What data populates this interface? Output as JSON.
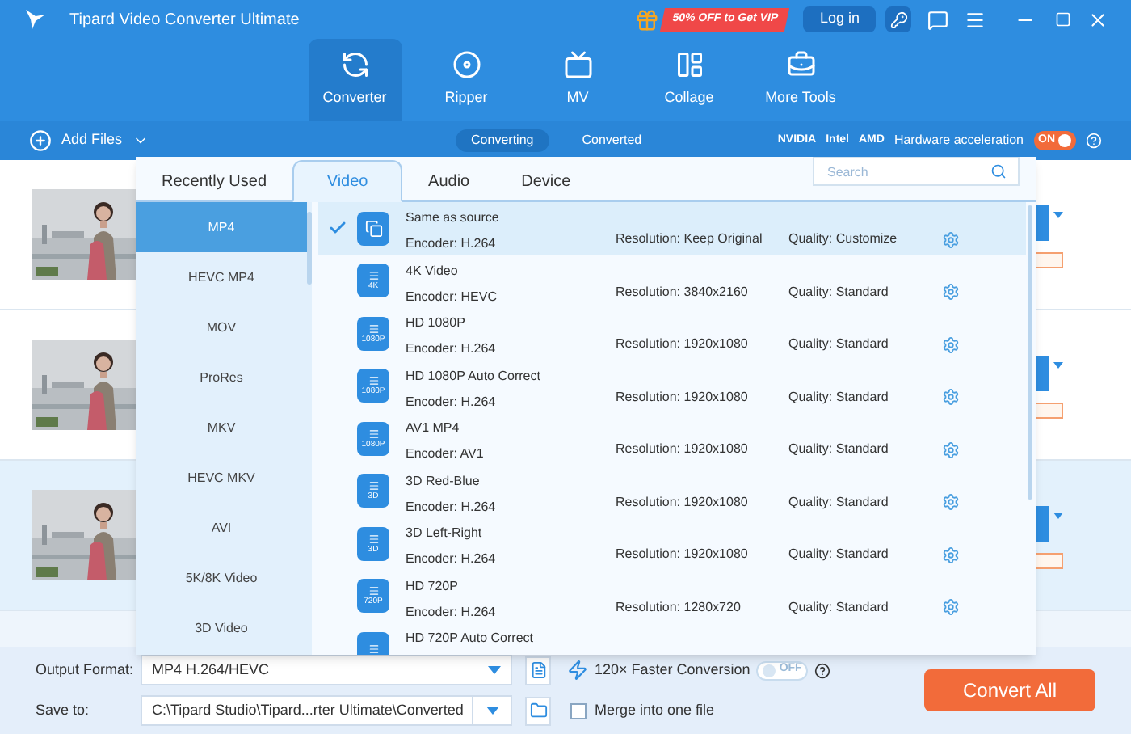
{
  "window": {
    "title": "Tipard Video Converter Ultimate"
  },
  "promo": {
    "label": "50% OFF to Get VIP"
  },
  "login": {
    "label": "Log in"
  },
  "nav": [
    {
      "label": "Converter",
      "selected": true
    },
    {
      "label": "Ripper",
      "selected": false
    },
    {
      "label": "MV",
      "selected": false
    },
    {
      "label": "Collage",
      "selected": false
    },
    {
      "label": "More Tools",
      "selected": false
    }
  ],
  "toolbar": {
    "add_files": "Add Files",
    "views": [
      {
        "label": "Converting",
        "selected": true
      },
      {
        "label": "Converted",
        "selected": false
      }
    ],
    "gpus": [
      "NVIDIA",
      "Intel",
      "AMD"
    ],
    "hw_label": "Hardware acceleration",
    "hw_toggle": {
      "label": "ON",
      "on": true
    }
  },
  "files": [
    {
      "kind": "picture",
      "selected": false
    },
    {
      "kind": "picture",
      "selected": false
    },
    {
      "kind": "picture",
      "selected": true
    }
  ],
  "format_panel": {
    "tabs": [
      {
        "label": "Recently Used",
        "selected": false
      },
      {
        "label": "Video",
        "selected": true
      },
      {
        "label": "Audio",
        "selected": false
      },
      {
        "label": "Device",
        "selected": false
      }
    ],
    "search": {
      "placeholder": "Search"
    },
    "formats": [
      {
        "label": "MP4",
        "selected": true
      },
      {
        "label": "HEVC MP4",
        "selected": false
      },
      {
        "label": "MOV",
        "selected": false
      },
      {
        "label": "ProRes",
        "selected": false
      },
      {
        "label": "MKV",
        "selected": false
      },
      {
        "label": "HEVC MKV",
        "selected": false
      },
      {
        "label": "AVI",
        "selected": false
      },
      {
        "label": "5K/8K Video",
        "selected": false
      },
      {
        "label": "3D Video",
        "selected": false
      }
    ],
    "presets": [
      {
        "kind": "source",
        "name": "Same as source",
        "encoder": "Encoder: H.264",
        "resolution": "Resolution: Keep Original",
        "quality": "Quality: Customize",
        "selected": true
      },
      {
        "kind": "video",
        "badge": "4K",
        "name": "4K Video",
        "encoder": "Encoder: HEVC",
        "resolution": "Resolution: 3840x2160",
        "quality": "Quality: Standard",
        "selected": false
      },
      {
        "kind": "video",
        "badge": "1080P",
        "name": "HD 1080P",
        "encoder": "Encoder: H.264",
        "resolution": "Resolution: 1920x1080",
        "quality": "Quality: Standard",
        "selected": false
      },
      {
        "kind": "video",
        "badge": "1080P",
        "name": "HD 1080P Auto Correct",
        "encoder": "Encoder: H.264",
        "resolution": "Resolution: 1920x1080",
        "quality": "Quality: Standard",
        "selected": false
      },
      {
        "kind": "video",
        "badge": "1080P",
        "name": "AV1 MP4",
        "encoder": "Encoder: AV1",
        "resolution": "Resolution: 1920x1080",
        "quality": "Quality: Standard",
        "selected": false
      },
      {
        "kind": "stereo",
        "badge": "3D",
        "name": "3D Red-Blue",
        "encoder": "Encoder: H.264",
        "resolution": "Resolution: 1920x1080",
        "quality": "Quality: Standard",
        "selected": false
      },
      {
        "kind": "stereo",
        "badge": "3D",
        "name": "3D Left-Right",
        "encoder": "Encoder: H.264",
        "resolution": "Resolution: 1920x1080",
        "quality": "Quality: Standard",
        "selected": false
      },
      {
        "kind": "video",
        "badge": "720P",
        "name": "HD 720P",
        "encoder": "Encoder: H.264",
        "resolution": "Resolution: 1280x720",
        "quality": "Quality: Standard",
        "selected": false
      },
      {
        "kind": "video",
        "name": "HD 720P Auto Correct",
        "selected": false
      }
    ]
  },
  "bottom": {
    "output_label": "Output Format:",
    "output_value": "MP4 H.264/HEVC",
    "faster": "120× Faster Conversion",
    "faster_toggle": {
      "label": "OFF",
      "on": false
    },
    "save_label": "Save to:",
    "save_value": "C:\\Tipard Studio\\Tipard...rter Ultimate\\Converted",
    "merge": {
      "label": "Merge into one file",
      "checked": false
    },
    "convert": "Convert All"
  }
}
